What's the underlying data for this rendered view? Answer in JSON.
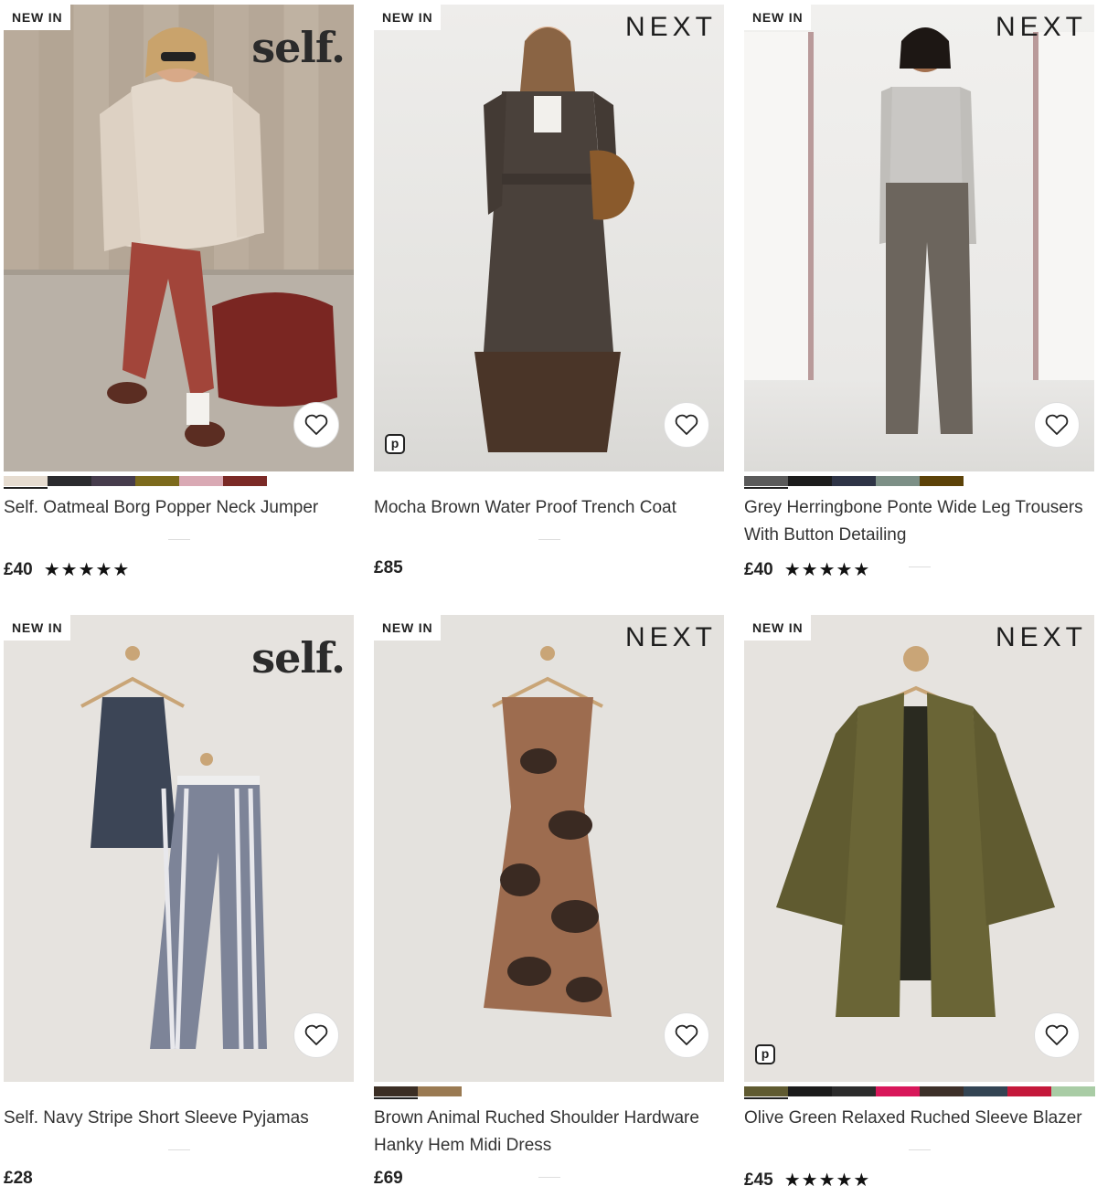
{
  "products": [
    {
      "badge": "NEW IN",
      "brand": "self.",
      "title": "Self. Oatmeal Borg Popper Neck Jumper",
      "price": "£40",
      "rating": 5,
      "rating_text": "★★★★★",
      "swatches": [
        "#e6dcd0",
        "#2b2b2e",
        "#463c4c",
        "#7c6a1c",
        "#d9a9b4",
        "#7b2a26"
      ],
      "image": "woman-sitting-oatmeal-jumper",
      "pay_badge": false
    },
    {
      "badge": "NEW IN",
      "brand": "NEXT",
      "title": "Mocha Brown Water Proof Trench Coat",
      "price": "£85",
      "rating": null,
      "rating_text": "",
      "swatches": [],
      "image": "woman-brown-trench-coat",
      "pay_badge": true,
      "pay_badge_letter": "p"
    },
    {
      "badge": "NEW IN",
      "brand": "NEXT",
      "title": "Grey Herringbone Ponte Wide Leg Trousers With Button Detailing",
      "price": "£40",
      "rating": 5,
      "rating_text": "★★★★★",
      "swatches": [
        "#5a5a5a",
        "#1c1c1c",
        "#2e3446",
        "#7c8f86",
        "#5c4208"
      ],
      "image": "woman-grey-trousers",
      "pay_badge": false
    },
    {
      "badge": "NEW IN",
      "brand": "self.",
      "title": "Self. Navy Stripe Short Sleeve Pyjamas",
      "price": "£28",
      "rating": null,
      "rating_text": "",
      "swatches": [],
      "image": "navy-stripe-pyjamas-on-hanger",
      "pay_badge": false
    },
    {
      "badge": "NEW IN",
      "brand": "NEXT",
      "title": "Brown Animal Ruched Shoulder Hardware Hanky Hem Midi Dress",
      "price": "£69",
      "rating": null,
      "rating_text": "",
      "swatches": [
        "#3b2e24",
        "#9a7a52"
      ],
      "image": "animal-print-dress-on-hanger",
      "pay_badge": false
    },
    {
      "badge": "NEW IN",
      "brand": "NEXT",
      "title": "Olive Green Relaxed Ruched Sleeve Blazer",
      "price": "£45",
      "rating": 5,
      "rating_text": "★★★★★",
      "swatches": [
        "#5f5a30",
        "#1b1b1b",
        "#2c2c2c",
        "#d8175a",
        "#3d3029",
        "#334453",
        "#c4183a",
        "#a9cca5"
      ],
      "image": "olive-blazer-on-hanger",
      "pay_badge": true,
      "pay_badge_letter": "p"
    }
  ]
}
